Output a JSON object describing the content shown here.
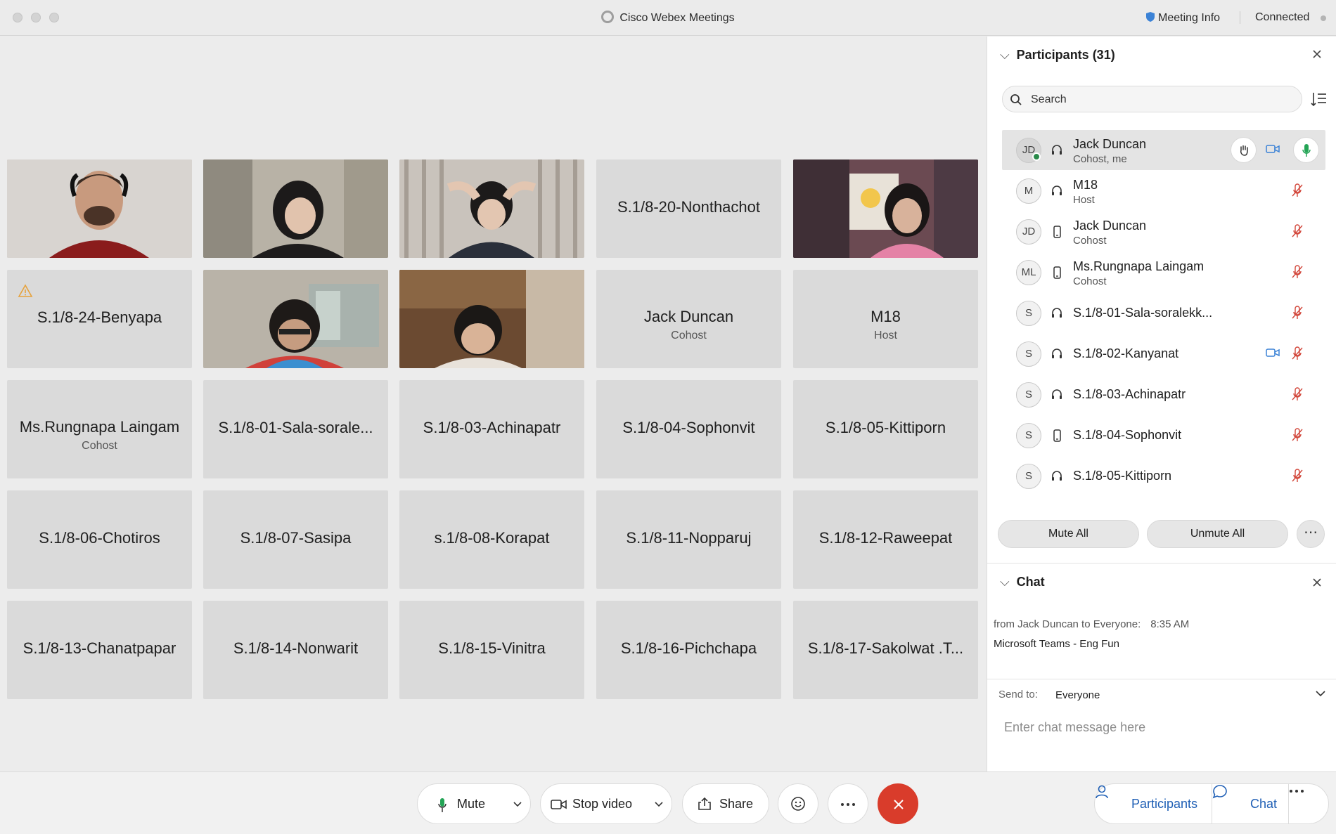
{
  "window": {
    "title": "Cisco Webex Meetings",
    "meeting_info_label": "Meeting Info",
    "connection_status": "Connected"
  },
  "grid": {
    "tiles": [
      {
        "type": "video",
        "label": ""
      },
      {
        "type": "video",
        "label": ""
      },
      {
        "type": "video",
        "label": ""
      },
      {
        "type": "name",
        "label": "S.1/8-20-Nonthachot"
      },
      {
        "type": "video",
        "label": ""
      },
      {
        "type": "name",
        "label": "S.1/8-24-Benyapa",
        "warning": true
      },
      {
        "type": "video",
        "label": ""
      },
      {
        "type": "video",
        "label": ""
      },
      {
        "type": "name",
        "label": "Jack Duncan",
        "role": "Cohost"
      },
      {
        "type": "name",
        "label": "M18",
        "role": "Host"
      },
      {
        "type": "name",
        "label": "Ms.Rungnapa Laingam",
        "role": "Cohost"
      },
      {
        "type": "name",
        "label": "S.1/8-01-Sala-sorale..."
      },
      {
        "type": "name",
        "label": "S.1/8-03-Achinapatr"
      },
      {
        "type": "name",
        "label": "S.1/8-04-Sophonvit"
      },
      {
        "type": "name",
        "label": "S.1/8-05-Kittiporn"
      },
      {
        "type": "name",
        "label": "S.1/8-06-Chotiros"
      },
      {
        "type": "name",
        "label": "S.1/8-07-Sasipa"
      },
      {
        "type": "name",
        "label": "s.1/8-08-Korapat"
      },
      {
        "type": "name",
        "label": "S.1/8-11-Nopparuj"
      },
      {
        "type": "name",
        "label": "S.1/8-12-Raweepat"
      },
      {
        "type": "name",
        "label": "S.1/8-13-Chanatpapar"
      },
      {
        "type": "name",
        "label": "S.1/8-14-Nonwarit"
      },
      {
        "type": "name",
        "label": "S.1/8-15-Vinitra"
      },
      {
        "type": "name",
        "label": "S.1/8-16-Pichchapa"
      },
      {
        "type": "name",
        "label": "S.1/8-17-Sakolwat .T..."
      }
    ]
  },
  "participants": {
    "title": "Participants (31)",
    "search_placeholder": "Search",
    "list": [
      {
        "initials": "JD",
        "name": "Jack Duncan",
        "role": "Cohost, me",
        "device": "headset",
        "selected": true
      },
      {
        "initials": "M",
        "name": "M18",
        "role": "Host",
        "device": "headset"
      },
      {
        "initials": "JD",
        "name": "Jack Duncan",
        "role": "Cohost",
        "device": "phone"
      },
      {
        "initials": "ML",
        "name": "Ms.Rungnapa Laingam",
        "role": "Cohost",
        "device": "phone"
      },
      {
        "initials": "S",
        "name": "S.1/8-01-Sala-soralekk...",
        "role": "",
        "device": "headset"
      },
      {
        "initials": "S",
        "name": "S.1/8-02-Kanyanat",
        "role": "",
        "device": "headset",
        "video": true
      },
      {
        "initials": "S",
        "name": "S.1/8-03-Achinapatr",
        "role": "",
        "device": "headset"
      },
      {
        "initials": "S",
        "name": "S.1/8-04-Sophonvit",
        "role": "",
        "device": "phone"
      },
      {
        "initials": "S",
        "name": "S.1/8-05-Kittiporn",
        "role": "",
        "device": "headset"
      }
    ],
    "mute_all": "Mute All",
    "unmute_all": "Unmute All"
  },
  "chat": {
    "title": "Chat",
    "meta": "from Jack Duncan to Everyone:",
    "time": "8:35  AM",
    "message": "Microsoft Teams - Eng Fun",
    "send_to_label": "Send to:",
    "send_to_value": "Everyone",
    "input_placeholder": "Enter chat message here"
  },
  "controls": {
    "mute": "Mute",
    "stop_video": "Stop video",
    "share": "Share",
    "participants": "Participants",
    "chat": "Chat"
  },
  "colors": {
    "end_call": "#d93c2b",
    "accent_blue": "#1f5fb5",
    "presence_green": "#2a8a4a",
    "mic_green": "#23a455",
    "muted_red": "#d2463a"
  }
}
